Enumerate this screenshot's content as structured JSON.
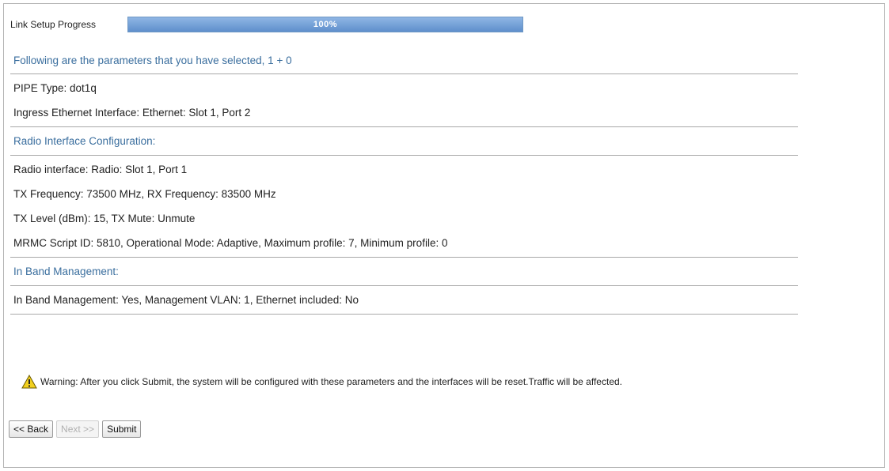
{
  "progress": {
    "label": "Link Setup Progress",
    "value_text": "100%",
    "percent": 100
  },
  "sections": {
    "intro_heading": "Following are the parameters that you have selected, 1 + 0",
    "pipe_type": "PIPE Type: dot1q",
    "ingress": "Ingress Ethernet Interface: Ethernet: Slot 1, Port 2",
    "radio_heading": "Radio Interface Configuration:",
    "radio_interface": "Radio interface: Radio: Slot 1, Port 1",
    "frequency": "TX Frequency: 73500 MHz, RX Frequency: 83500 MHz",
    "tx_level": "TX Level (dBm): 15, TX Mute: Unmute",
    "mrmc": "MRMC Script ID: 5810, Operational Mode: Adaptive, Maximum profile: 7, Minimum profile: 0",
    "inband_heading": "In Band Management:",
    "inband": "In Band Management: Yes, Management VLAN: 1, Ethernet included: No"
  },
  "warning": {
    "icon": "warning-icon",
    "text": "Warning: After you click Submit, the system will be configured with these parameters and the interfaces will be reset.Traffic will be affected."
  },
  "buttons": {
    "back": "<< Back",
    "next": "Next >>",
    "submit": "Submit"
  },
  "colors": {
    "heading": "#3a6e9e",
    "progress_fill": "#5f8fcc"
  }
}
